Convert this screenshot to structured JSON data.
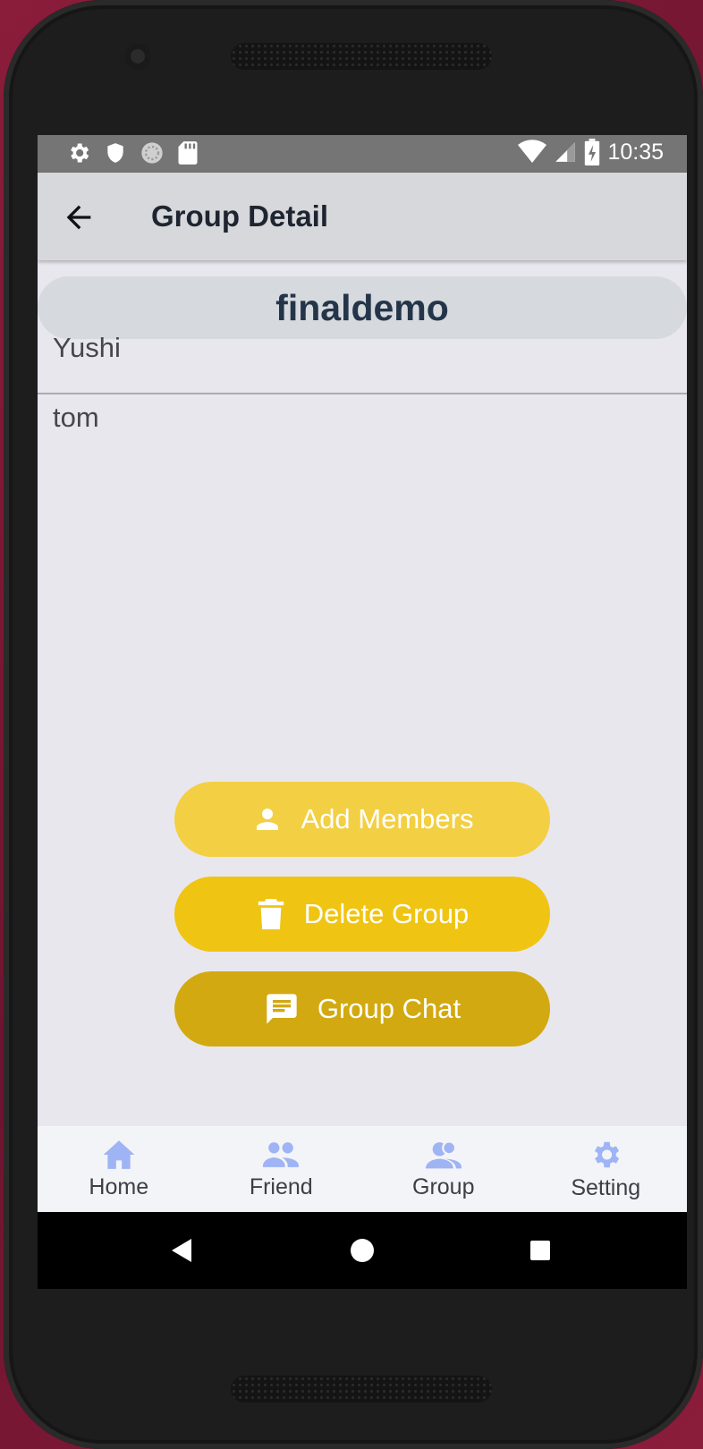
{
  "status_bar": {
    "time": "10:35",
    "left_icons": [
      "gear-icon",
      "shield-icon",
      "sync-icon",
      "sd-card-icon"
    ],
    "right_icons": [
      "wifi-icon",
      "signal-icon",
      "battery-charging-icon"
    ]
  },
  "app_bar": {
    "title": "Group Detail",
    "back_icon": "arrow-left-icon"
  },
  "group": {
    "name": "finaldemo",
    "members": [
      "Yushi",
      "tom"
    ]
  },
  "actions": {
    "add_members": "Add Members",
    "delete_group": "Delete Group",
    "group_chat": "Group Chat"
  },
  "bottom_nav": {
    "items": [
      {
        "label": "Home",
        "icon": "home-icon"
      },
      {
        "label": "Friend",
        "icon": "people-icon"
      },
      {
        "label": "Group",
        "icon": "group-icon"
      },
      {
        "label": "Setting",
        "icon": "gear-icon"
      }
    ],
    "icon_color": "#9fb4f5"
  },
  "colors": {
    "add_members": "#f3cf43",
    "delete_group": "#f0c413",
    "group_chat": "#d2a910"
  }
}
